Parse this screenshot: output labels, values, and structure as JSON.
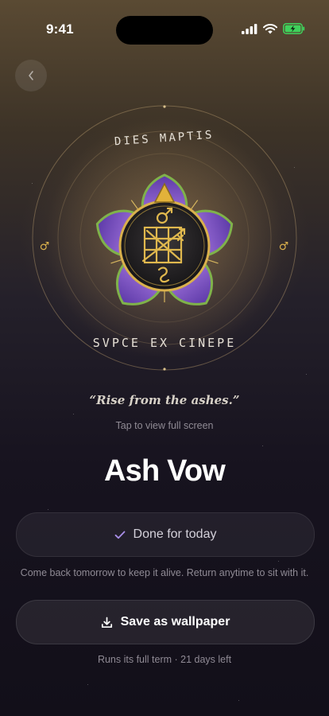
{
  "status_bar": {
    "time": "9:41"
  },
  "sigil": {
    "top_inscription": "DIES MAPTIS",
    "bottom_inscription": "SVPCE EX CINEPE",
    "side_symbol": "♂"
  },
  "quote": "“Rise from the ashes.”",
  "hint": "Tap to view full screen",
  "title": "Ash Vow",
  "done_button": {
    "label": "Done for today"
  },
  "note": "Come back tomorrow to keep it alive. Return anytime to sit with it.",
  "save_button": {
    "label": "Save as wallpaper"
  },
  "term": "Runs its full term · 21 days left",
  "colors": {
    "accent_check": "#a98ee8",
    "gold": "#d9b04c",
    "petal_purple": "#8b5fc6"
  }
}
